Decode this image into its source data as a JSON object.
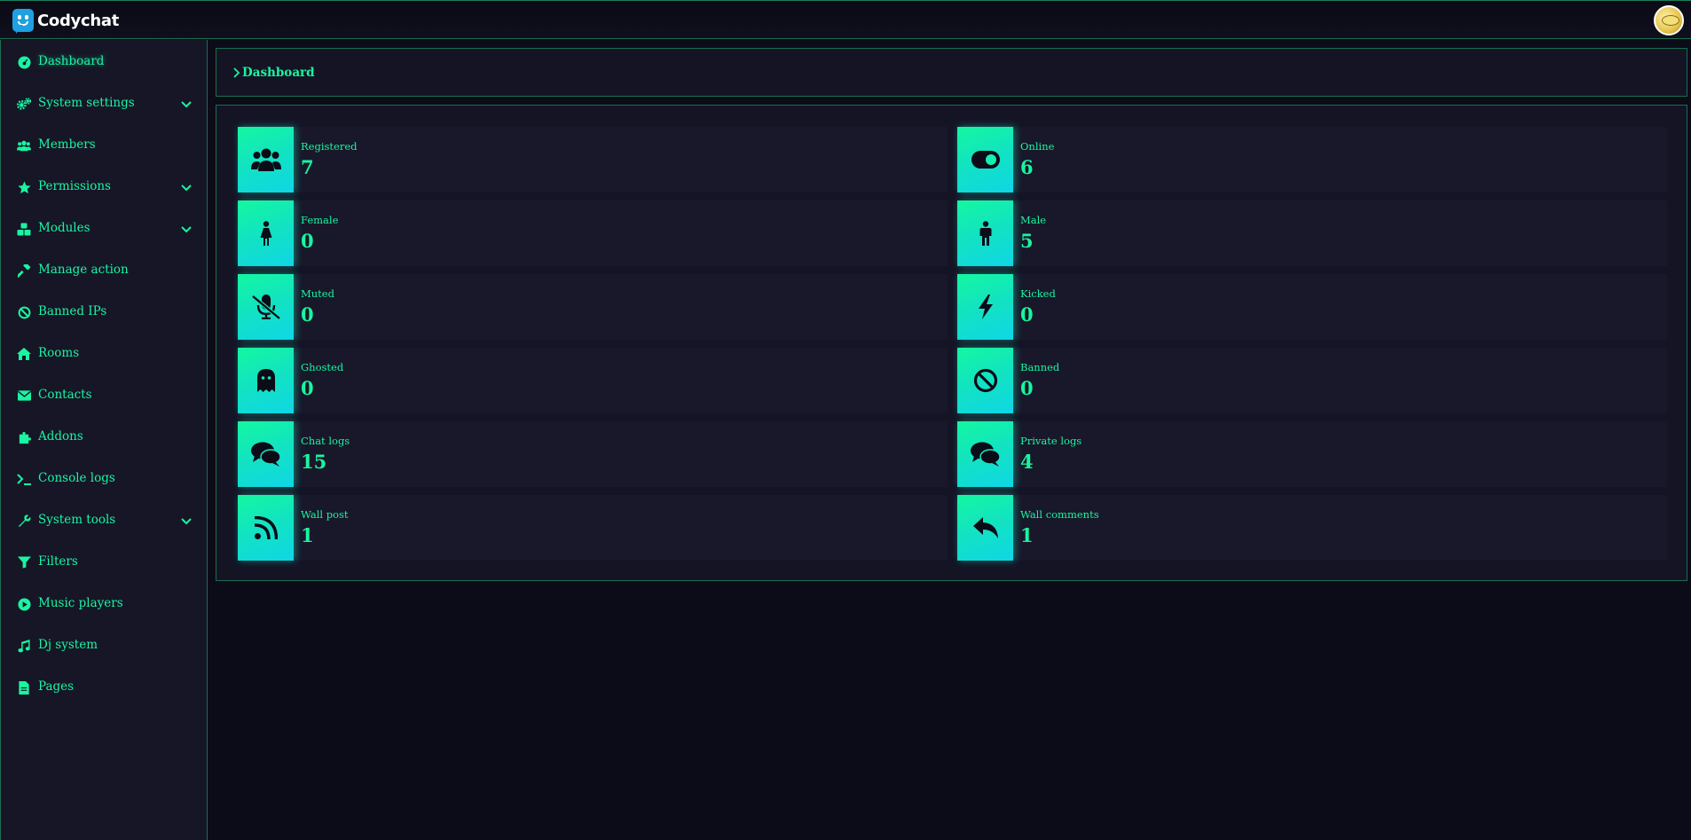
{
  "app": {
    "name": "Codychat"
  },
  "colors": {
    "accent": "#19f5a0",
    "background": "#0c0c18",
    "panel": "#141425",
    "border": "#1a6d4f"
  },
  "sidebar": {
    "items": [
      {
        "label": "Dashboard",
        "icon": "dashboard-icon",
        "active": true,
        "expandable": false
      },
      {
        "label": "System settings",
        "icon": "cogs-icon",
        "expandable": true
      },
      {
        "label": "Members",
        "icon": "users-icon",
        "expandable": false
      },
      {
        "label": "Permissions",
        "icon": "star-icon",
        "expandable": true
      },
      {
        "label": "Modules",
        "icon": "cubes-icon",
        "expandable": true
      },
      {
        "label": "Manage action",
        "icon": "hammer-icon",
        "expandable": false
      },
      {
        "label": "Banned IPs",
        "icon": "ban-icon",
        "expandable": false
      },
      {
        "label": "Rooms",
        "icon": "home-icon",
        "expandable": false
      },
      {
        "label": "Contacts",
        "icon": "envelope-icon",
        "expandable": false
      },
      {
        "label": "Addons",
        "icon": "puzzle-icon",
        "expandable": false
      },
      {
        "label": "Console logs",
        "icon": "terminal-icon",
        "expandable": false
      },
      {
        "label": "System tools",
        "icon": "wrench-icon",
        "expandable": true
      },
      {
        "label": "Filters",
        "icon": "filter-icon",
        "expandable": false
      },
      {
        "label": "Music players",
        "icon": "play-circle-icon",
        "expandable": false
      },
      {
        "label": "Dj system",
        "icon": "music-icon",
        "expandable": false
      },
      {
        "label": "Pages",
        "icon": "file-icon",
        "expandable": false
      }
    ]
  },
  "breadcrumb": {
    "current": "Dashboard"
  },
  "stats": [
    {
      "label": "Registered",
      "value": "7",
      "icon": "users-icon"
    },
    {
      "label": "Online",
      "value": "6",
      "icon": "toggle-on-icon"
    },
    {
      "label": "Female",
      "value": "0",
      "icon": "female-icon"
    },
    {
      "label": "Male",
      "value": "5",
      "icon": "male-icon"
    },
    {
      "label": "Muted",
      "value": "0",
      "icon": "microphone-slash-icon"
    },
    {
      "label": "Kicked",
      "value": "0",
      "icon": "bolt-icon"
    },
    {
      "label": "Ghosted",
      "value": "0",
      "icon": "ghost-icon"
    },
    {
      "label": "Banned",
      "value": "0",
      "icon": "ban-icon"
    },
    {
      "label": "Chat logs",
      "value": "15",
      "icon": "comments-icon"
    },
    {
      "label": "Private logs",
      "value": "4",
      "icon": "comments-icon"
    },
    {
      "label": "Wall post",
      "value": "1",
      "icon": "rss-icon"
    },
    {
      "label": "Wall comments",
      "value": "1",
      "icon": "reply-icon"
    }
  ]
}
